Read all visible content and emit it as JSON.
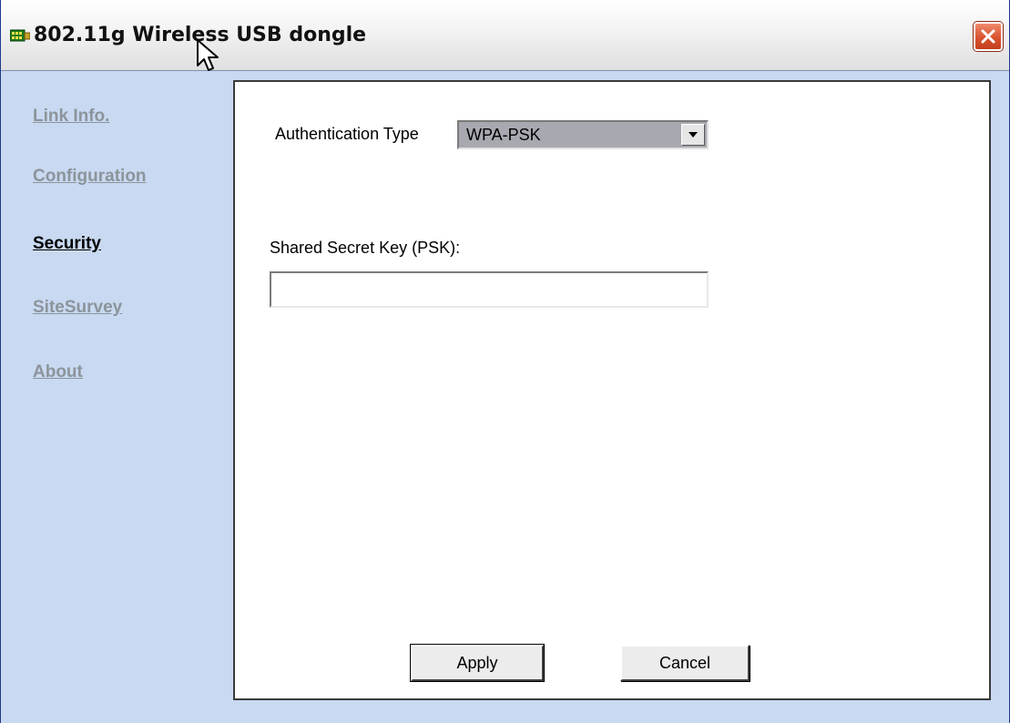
{
  "window": {
    "title": "802.11g Wireless USB dongle"
  },
  "icons": {
    "app": "network-adapter-icon",
    "close": "close-icon",
    "cursor": "mouse-pointer-icon",
    "dropdown_arrow": "chevron-down-icon"
  },
  "sidebar": {
    "items": [
      {
        "label": "Link Info.",
        "active": false
      },
      {
        "label": "Configuration",
        "active": false
      },
      {
        "label": "Security",
        "active": true
      },
      {
        "label": "SiteSurvey",
        "active": false
      },
      {
        "label": "About",
        "active": false
      }
    ]
  },
  "security": {
    "auth_type_label": "Authentication Type",
    "auth_type_value": "WPA-PSK",
    "psk_label": "Shared Secret Key (PSK):",
    "psk_value": "",
    "psk_placeholder": ""
  },
  "buttons": {
    "apply_label": "Apply",
    "cancel_label": "Cancel"
  },
  "colors": {
    "window_bg": "#c8d9f1",
    "panel_bg": "#ffffff",
    "active_link": "#000000",
    "inactive_link": "#8c949b",
    "close_button": "#d9532f"
  }
}
